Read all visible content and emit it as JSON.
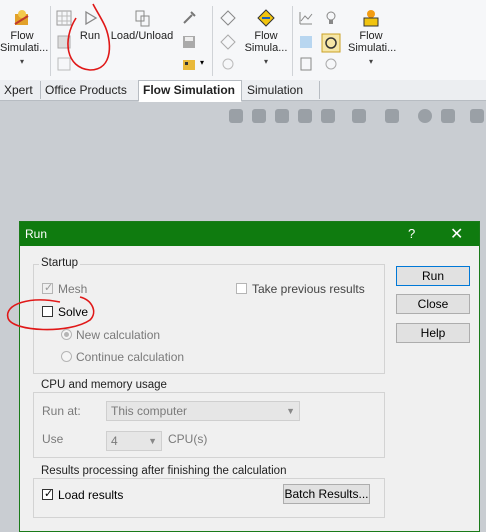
{
  "ribbon": {
    "flow_sim1": {
      "label": "Flow\nSimulati...",
      "dropdown": "▾"
    },
    "run": {
      "label": "Run"
    },
    "load_unload": {
      "label": "Load/Unload"
    },
    "flow_sim2": {
      "label": "Flow\nSimula...",
      "dropdown": "▾"
    },
    "flow_sim3": {
      "label": "Flow\nSimulati...",
      "dropdown": "▾"
    },
    "small_dropdown": "▾"
  },
  "tabs": [
    "Xpert",
    "Office Products",
    "Flow Simulation",
    "Simulation"
  ],
  "dialog": {
    "title": "Run",
    "help_glyph": "?",
    "close_glyph": "✕",
    "startup": {
      "title": "Startup",
      "mesh": "Mesh",
      "take_previous": "Take previous results",
      "solve": "Solve",
      "new_calc": "New calculation",
      "continue_calc": "Continue calculation"
    },
    "cpu": {
      "title": "CPU and memory usage",
      "run_at_label": "Run at:",
      "run_at_value": "This computer",
      "use_label": "Use",
      "use_value": "4",
      "cpu_unit": "CPU(s)"
    },
    "results": {
      "title": "Results processing after finishing the calculation",
      "load_results": "Load results",
      "batch_results": "Batch Results..."
    },
    "buttons": {
      "run": "Run",
      "close": "Close",
      "help": "Help"
    },
    "checkmark": "✓"
  },
  "colors": {
    "titlebar": "#0f7b0f",
    "annotation": "#e01818"
  }
}
